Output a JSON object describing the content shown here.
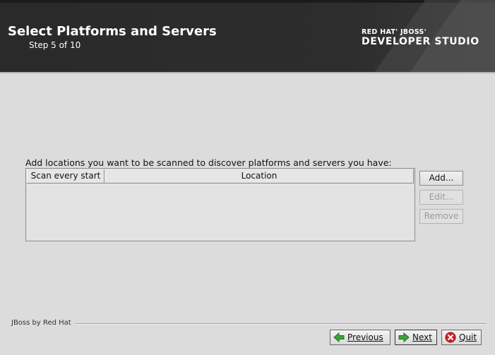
{
  "header": {
    "title": "Select Platforms and Servers",
    "step": "Step 5 of 10",
    "logo_line1": "RED HAT' JBOSS'",
    "logo_line2": "DEVELOPER STUDIO"
  },
  "main": {
    "instructions": "Add locations you want to be scanned to discover platforms and servers you have:",
    "table": {
      "columns": [
        "Scan every start",
        "Location"
      ],
      "rows": []
    },
    "buttons": {
      "add": "Add...",
      "edit": "Edit...",
      "remove": "Remove"
    }
  },
  "footer": {
    "brand": "JBoss by Red Hat",
    "previous": "Previous",
    "next": "Next",
    "quit": "Quit"
  },
  "colors": {
    "header_bg": "#2d2d2d",
    "body_bg": "#dcdcdc",
    "next_arrow": "#2e9a2e",
    "previous_arrow": "#2e9a2e",
    "quit_icon": "#d42020"
  },
  "icons": {
    "previous": "arrow-left-icon",
    "next": "arrow-right-icon",
    "quit": "close-circle-icon"
  }
}
